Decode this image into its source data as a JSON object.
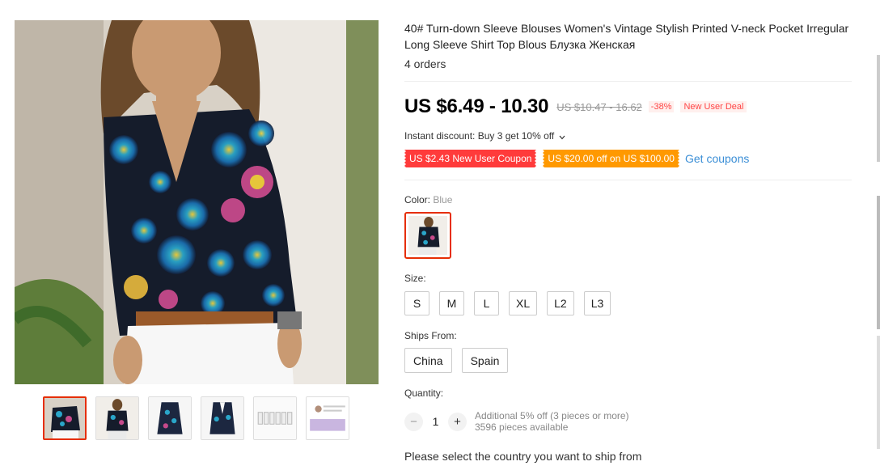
{
  "product": {
    "title": "40# Turn-down Sleeve Blouses Women's Vintage Stylish Printed V-neck Pocket Irregular Long Sleeve Shirt Top Blous Блузка Женская",
    "orders": "4 orders"
  },
  "price": {
    "current": "US $6.49 - 10.30",
    "original": "US $10.47 - 16.62",
    "discount": "-38%",
    "deal_badge": "New User Deal"
  },
  "promo": {
    "instant_discount": "Instant discount: Buy 3 get 10% off",
    "coupon_new_user": "US $2.43 New User Coupon",
    "coupon_store": "US $20.00 off on US $100.00",
    "get_coupons": "Get coupons"
  },
  "color": {
    "label": "Color:",
    "selected": "Blue"
  },
  "size": {
    "label": "Size:",
    "options": [
      "S",
      "M",
      "L",
      "XL",
      "L2",
      "L3"
    ]
  },
  "ships_from": {
    "label": "Ships From:",
    "options": [
      "China",
      "Spain"
    ]
  },
  "quantity": {
    "label": "Quantity:",
    "value": "1",
    "minus": "−",
    "plus": "+",
    "note": "Additional 5% off (3 pieces or more)",
    "available": "3596 pieces available"
  },
  "shipping": {
    "notice": "Please select the country you want to ship from"
  },
  "icons": {
    "chevron": "chevron-down-icon"
  },
  "colors": {
    "accent_red": "#e62e04",
    "coupon_red": "#ff3b3b",
    "coupon_orange": "#ff9900",
    "link_blue": "#3a8ed6"
  }
}
